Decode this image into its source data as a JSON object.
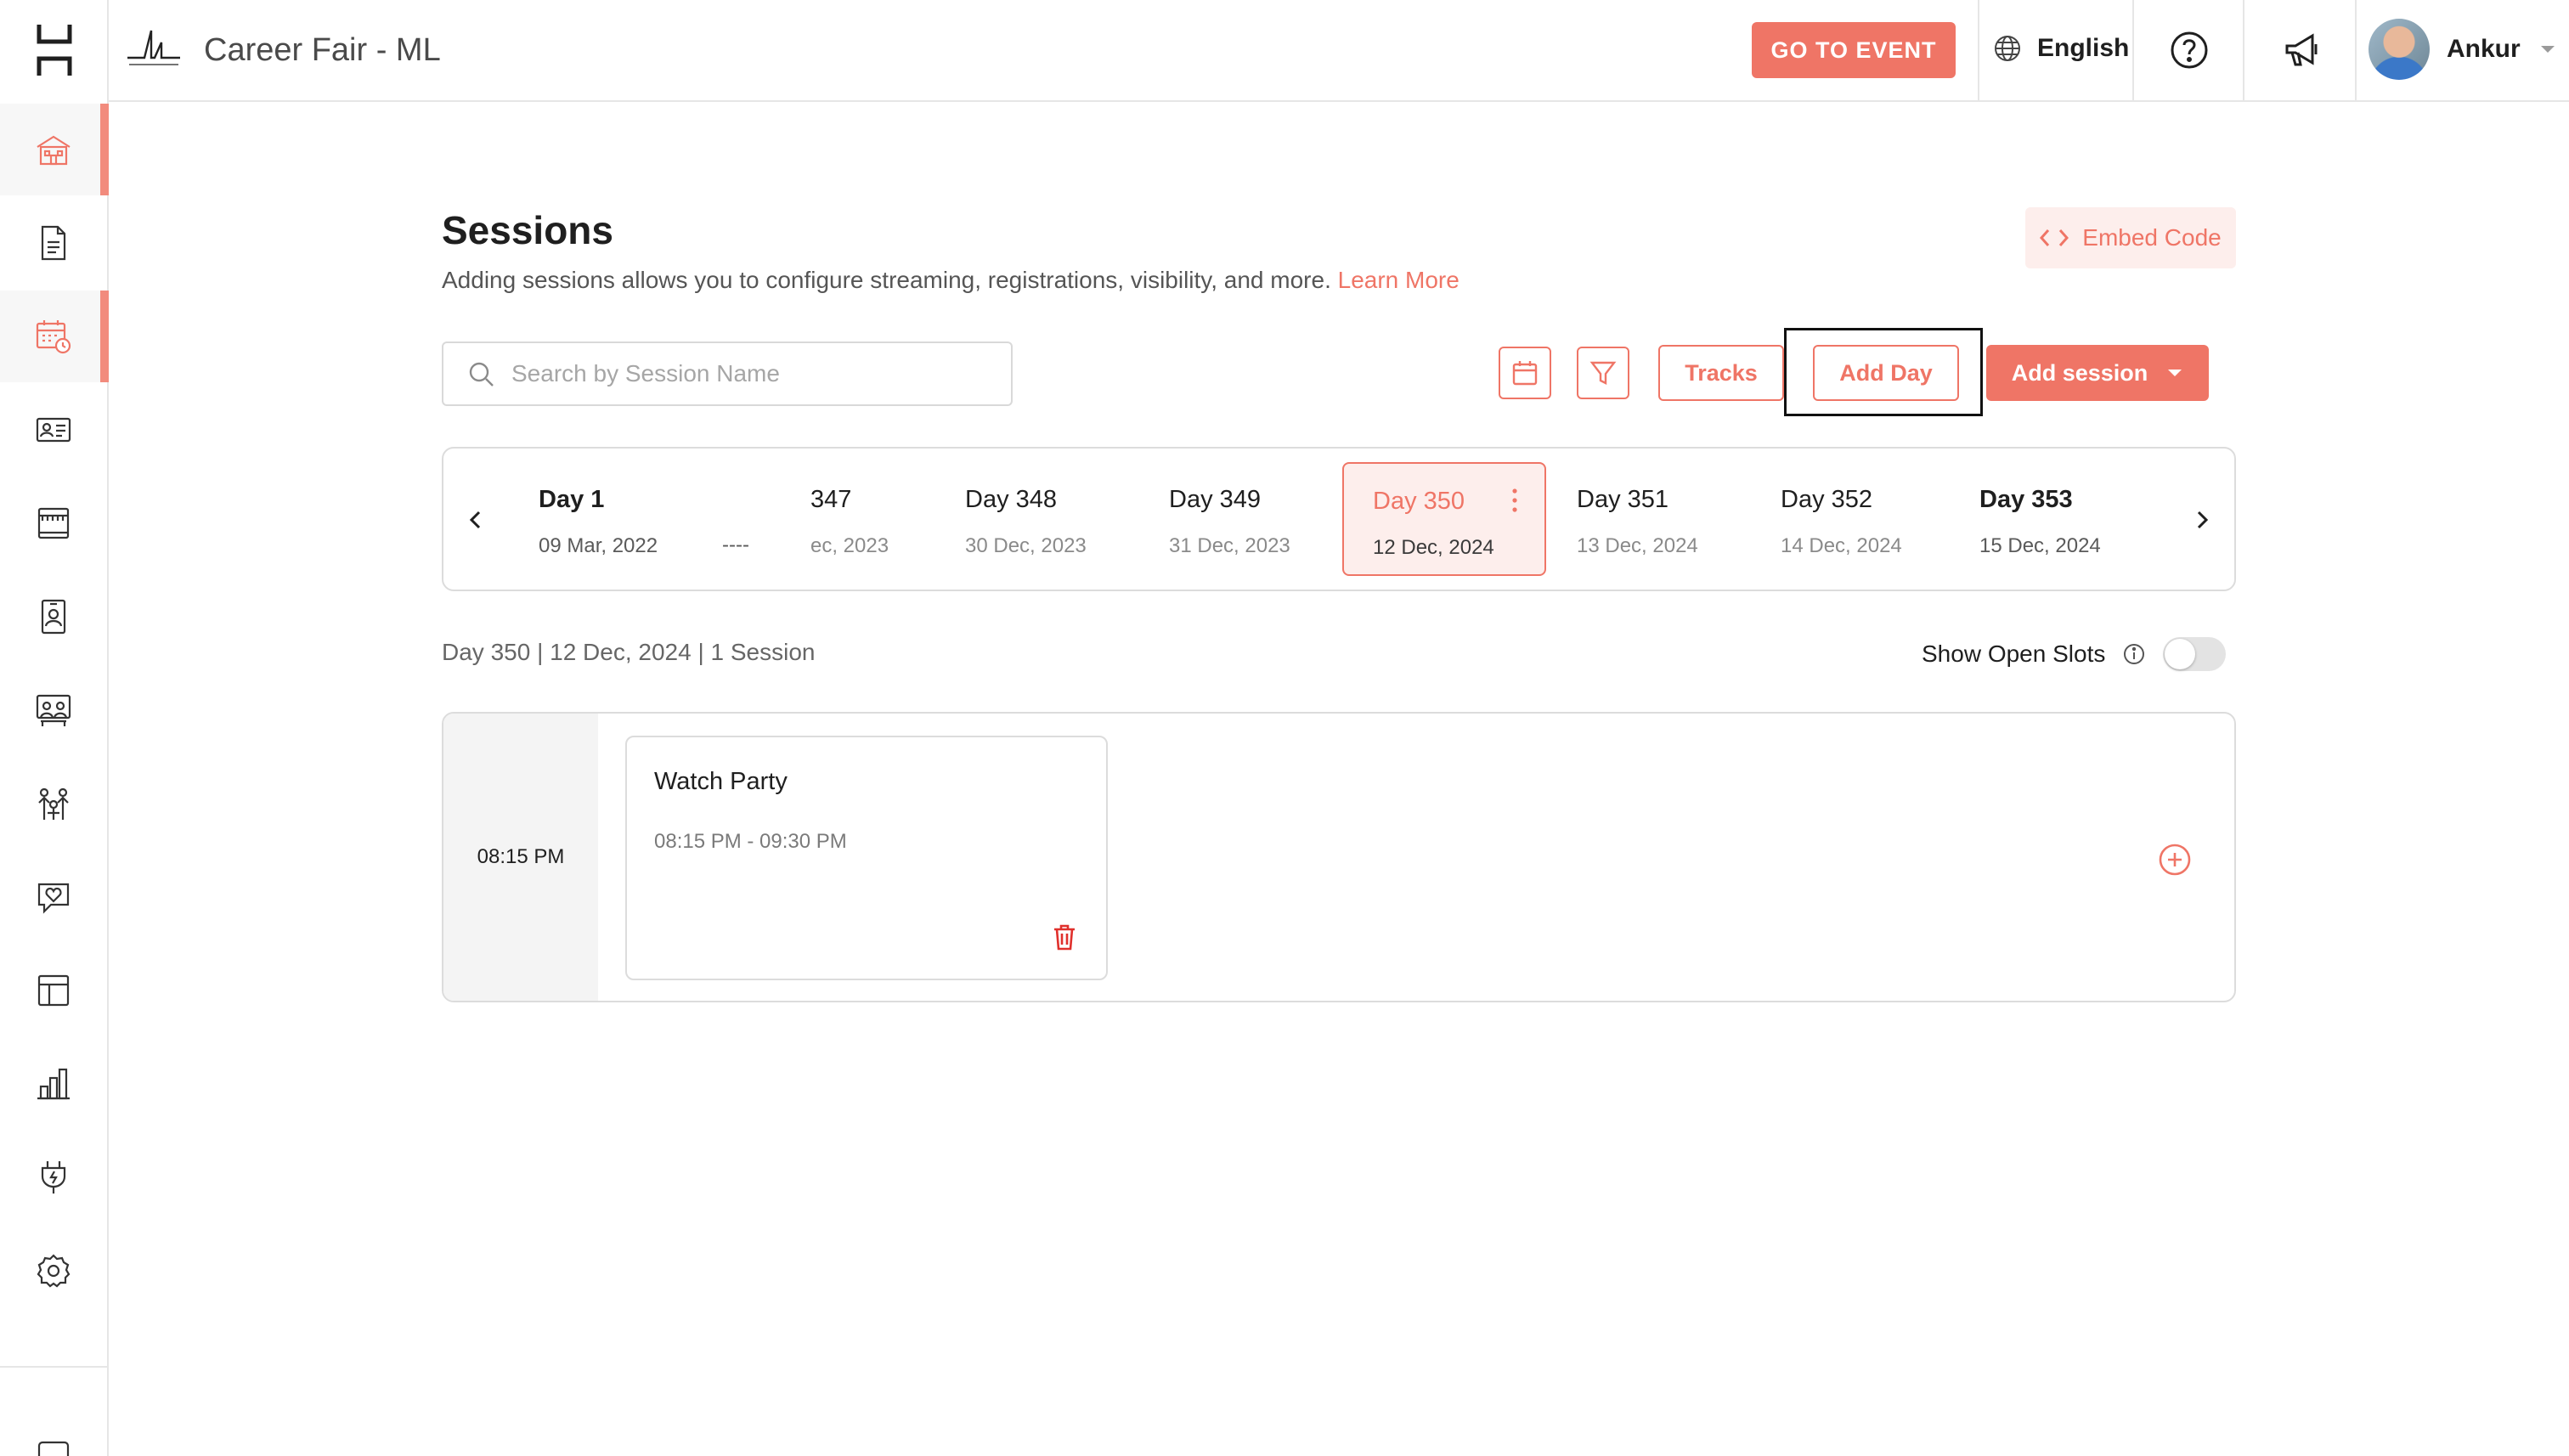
{
  "header": {
    "event_title": "Career Fair - ML",
    "go_to_event_label": "GO TO EVENT",
    "language": "English",
    "user_name": "Ankur"
  },
  "sidebar": {
    "items": [
      {
        "icon": "building-icon",
        "active": true
      },
      {
        "icon": "document-icon",
        "active": false
      },
      {
        "icon": "calendar-schedule-icon",
        "active": true
      },
      {
        "icon": "id-card-icon",
        "active": false
      },
      {
        "icon": "booth-icon",
        "active": false
      },
      {
        "icon": "badge-icon",
        "active": false
      },
      {
        "icon": "lounge-icon",
        "active": false
      },
      {
        "icon": "networking-icon",
        "active": false
      },
      {
        "icon": "engagement-heart-icon",
        "active": false
      },
      {
        "icon": "layout-icon",
        "active": false
      },
      {
        "icon": "analytics-icon",
        "active": false
      },
      {
        "icon": "integrations-plug-icon",
        "active": false
      },
      {
        "icon": "settings-gear-icon",
        "active": false
      }
    ]
  },
  "page": {
    "title": "Sessions",
    "description": "Adding sessions allows you to configure streaming, registrations, visibility, and more.",
    "learn_more": "Learn More",
    "embed_code_label": "Embed Code"
  },
  "toolbar": {
    "search_placeholder": "Search by Session Name",
    "tracks_label": "Tracks",
    "add_day_label": "Add Day",
    "add_session_label": "Add session"
  },
  "days": [
    {
      "name": "Day 1",
      "date": "09 Mar, 2022"
    },
    {
      "name": "347",
      "date": "ec, 2023"
    },
    {
      "name": "Day 348",
      "date": "30 Dec, 2023"
    },
    {
      "name": "Day 349",
      "date": "31 Dec, 2023"
    },
    {
      "name": "Day 350",
      "date": "12 Dec, 2024"
    },
    {
      "name": "Day 351",
      "date": "13 Dec, 2024"
    },
    {
      "name": "Day 352",
      "date": "14 Dec, 2024"
    },
    {
      "name": "Day 353",
      "date": "15 Dec, 2024"
    }
  ],
  "day_gap": "----",
  "summary": {
    "text": "Day 350 | 12 Dec, 2024 | 1 Session",
    "show_open_slots_label": "Show Open Slots",
    "show_open_slots_on": false
  },
  "sessions": {
    "time_slot": "08:15 PM",
    "card": {
      "name": "Watch Party",
      "time_range": "08:15 PM - 09:30 PM"
    }
  },
  "colors": {
    "accent": "#ef7566",
    "accent_light": "#fdeeec"
  }
}
